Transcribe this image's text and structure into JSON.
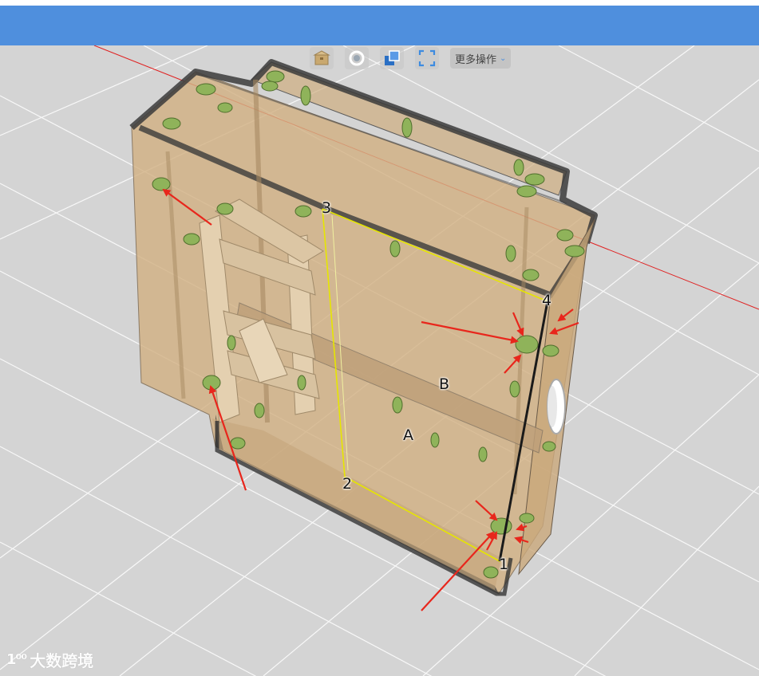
{
  "toolbar": {
    "buttons": [
      {
        "name": "box-view-icon"
      },
      {
        "name": "target-icon"
      },
      {
        "name": "layers-icon"
      },
      {
        "name": "fullscreen-icon"
      }
    ],
    "more_label": "更多操作"
  },
  "scene": {
    "point_labels": [
      "1",
      "2",
      "3",
      "4"
    ],
    "face_labels": [
      "A",
      "B"
    ]
  },
  "watermark": {
    "logo_text": "1⁰⁰",
    "text": "大数跨境"
  },
  "colors": {
    "topbar": "#4f8fdd",
    "viewport_bg": "#d4d4d4",
    "cabinet_fill": "#d2b184",
    "highlight_line": "#e6e600",
    "annotation_arrow": "#e8261c",
    "axis_line": "#e02020"
  }
}
